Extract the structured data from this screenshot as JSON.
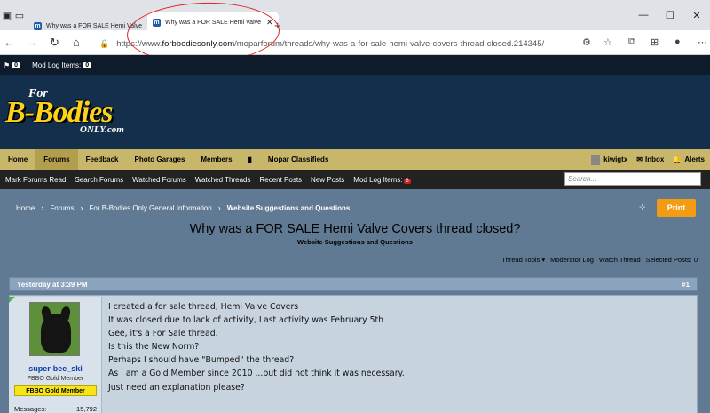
{
  "browser": {
    "tabs": [
      {
        "title": "Why was a FOR SALE Hemi Valve",
        "active": false
      },
      {
        "title": "Why was a FOR SALE Hemi Valve",
        "active": true
      }
    ],
    "url": {
      "prefix": "https://www.",
      "domain": "forbbodiesonly.com",
      "path": "/moparforum/threads/why-was-a-for-sale-hemi-valve-covers-thread-closed.214345/"
    }
  },
  "admin": {
    "flag_count": "0",
    "mod_log_label": "Mod Log Items:",
    "mod_log_count": "0"
  },
  "logo": {
    "for": "For",
    "bbodies": "B-Bodies",
    "only": "ONLY.com"
  },
  "main_nav": {
    "items": [
      "Home",
      "Forums",
      "Feedback",
      "Photo Garages",
      "Members",
      "Mopar Classifieds"
    ],
    "active": "Forums",
    "user": "kiwigtx",
    "inbox": "Inbox",
    "alerts": "Alerts"
  },
  "sub_nav": {
    "items": [
      "Mark Forums Read",
      "Search Forums",
      "Watched Forums",
      "Watched Threads",
      "Recent Posts",
      "New Posts"
    ],
    "mod_log_label": "Mod Log Items:",
    "mod_log_count": "8",
    "search_placeholder": "Search..."
  },
  "breadcrumb": [
    "Home",
    "Forums",
    "For B-Bodies Only General Information",
    "Website Suggestions and Questions"
  ],
  "print_label": "Print",
  "thread": {
    "title": "Why was a FOR SALE Hemi Valve Covers thread closed?",
    "forum": "Website Suggestions and Questions",
    "tools": [
      "Thread Tools ▾",
      "Moderator Log",
      "Watch Thread",
      "Selected Posts: 0"
    ]
  },
  "post": {
    "time": "Yesterday at 3:39 PM",
    "number": "#1",
    "author": "super-bee_ski",
    "user_title": "FBBO Gold Member",
    "banner": "FBBO Gold Member",
    "stat_label": "Messages:",
    "stat_value": "15,792",
    "lines": [
      "I created a for sale thread, Hemi Valve Covers",
      "It was closed due to lack of activity, Last activity was February 5th",
      "Gee, it's a For Sale thread.",
      "Is this the New Norm?",
      "Perhaps I should have \"Bumped\" the thread?",
      "As I am a Gold Member since 2010 ...but did not think it was necessary.",
      "Just need an explanation please?"
    ]
  },
  "colors": {
    "accent": "#f39c12",
    "nav_gold": "#c8b66a",
    "header_navy": "#132f4c",
    "annotation_red": "#e02020"
  }
}
